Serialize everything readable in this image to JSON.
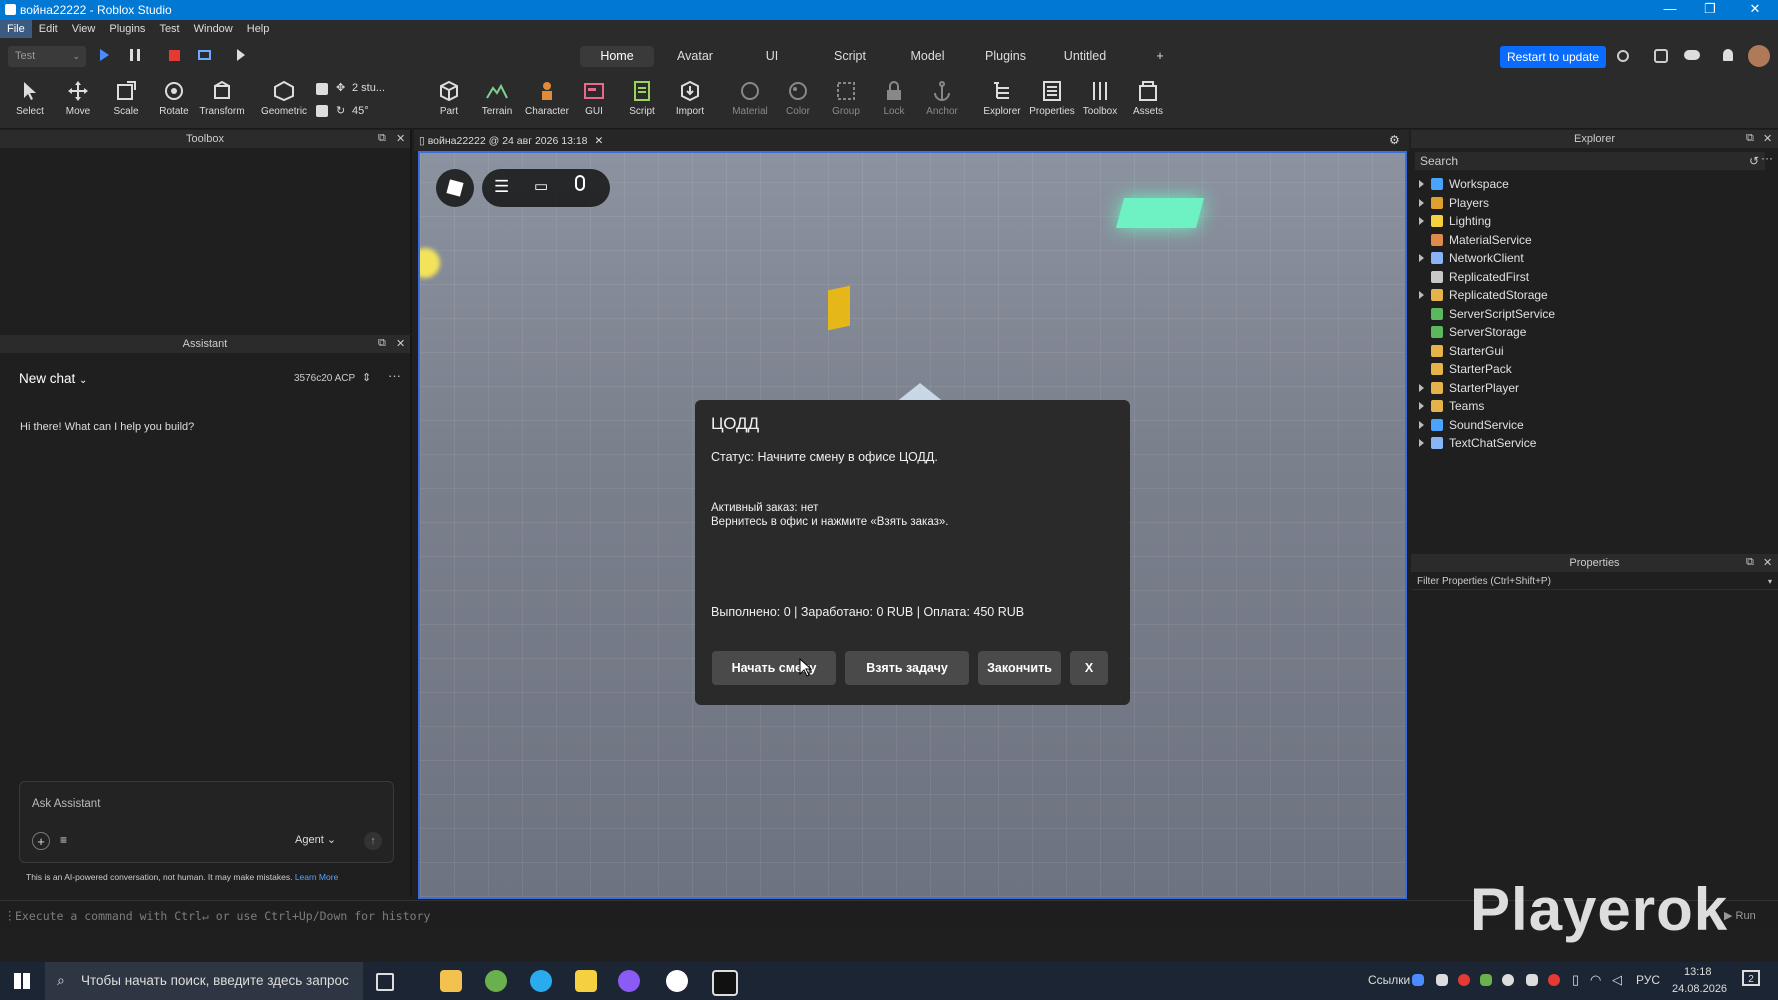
{
  "window": {
    "title": "война22222 - Roblox Studio",
    "controls": [
      "—",
      "❐",
      "✕"
    ]
  },
  "menu": [
    "File",
    "Edit",
    "View",
    "Plugins",
    "Test",
    "Window",
    "Help"
  ],
  "top": {
    "mode_select": "Test",
    "tabs": [
      "Home",
      "Avatar",
      "UI",
      "Script",
      "Model",
      "Plugins",
      "Untitled",
      "+"
    ],
    "active_tab": "Home",
    "restart_label": "Restart to update"
  },
  "ribbon": {
    "tools": [
      "Select",
      "Move",
      "Scale",
      "Rotate",
      "Transform",
      "Geometric"
    ],
    "move_snap": "2 stu...",
    "rotate_snap": "45°",
    "insert": [
      "Part",
      "Terrain",
      "Character",
      "GUI",
      "Script",
      "Import"
    ],
    "edit": [
      "Material",
      "Color",
      "Group",
      "Lock",
      "Anchor"
    ],
    "panels": [
      "Explorer",
      "Properties",
      "Toolbox",
      "Assets"
    ]
  },
  "toolbox": {
    "title": "Toolbox"
  },
  "assistant": {
    "title": "Assistant",
    "chat_title": "New chat",
    "tokens": "3576c20 ACP",
    "greeting": "Hi there! What can I help you build?",
    "input_placeholder": "Ask Assistant",
    "mode": "Agent",
    "disclaimer": "This is an AI-powered conversation, not human. It may make mistakes.",
    "learn_more": "Learn More"
  },
  "doc_tab": {
    "label": "война22222 @ 24 авг 2026 13:18"
  },
  "dialog": {
    "title": "ЦОДД",
    "status": "Статус: Начните смену в офисе ЦОДД.",
    "order_line1": "Активный заказ: нет",
    "order_line2": "Вернитесь в офис и нажмите «Взять заказ».",
    "stats": "Выполнено: 0 | Заработано: 0 RUB | Оплата: 450 RUB",
    "btn_start": "Начать смену",
    "btn_take": "Взять задачу",
    "btn_finish": "Закончить",
    "btn_close": "X"
  },
  "explorer": {
    "title": "Explorer",
    "search_placeholder": "Search",
    "items": [
      {
        "label": "Workspace",
        "expandable": true,
        "color": "#4aa3ff"
      },
      {
        "label": "Players",
        "expandable": true,
        "color": "#e0a030"
      },
      {
        "label": "Lighting",
        "expandable": true,
        "color": "#f5d142"
      },
      {
        "label": "MaterialService",
        "expandable": false,
        "color": "#e08a4a"
      },
      {
        "label": "NetworkClient",
        "expandable": true,
        "color": "#8ab4f8"
      },
      {
        "label": "ReplicatedFirst",
        "expandable": false,
        "color": "#c8c8c8"
      },
      {
        "label": "ReplicatedStorage",
        "expandable": true,
        "color": "#e6b34a"
      },
      {
        "label": "ServerScriptService",
        "expandable": false,
        "color": "#5cb85c"
      },
      {
        "label": "ServerStorage",
        "expandable": false,
        "color": "#5cb85c"
      },
      {
        "label": "StarterGui",
        "expandable": false,
        "color": "#e6b34a"
      },
      {
        "label": "StarterPack",
        "expandable": false,
        "color": "#e6b34a"
      },
      {
        "label": "StarterPlayer",
        "expandable": true,
        "color": "#e6b34a"
      },
      {
        "label": "Teams",
        "expandable": true,
        "color": "#e6b34a"
      },
      {
        "label": "SoundService",
        "expandable": true,
        "color": "#4aa3ff"
      },
      {
        "label": "TextChatService",
        "expandable": true,
        "color": "#8ab4f8"
      }
    ]
  },
  "properties": {
    "title": "Properties",
    "filter_placeholder": "Filter Properties (Ctrl+Shift+P)"
  },
  "command": {
    "placeholder": "Execute a command with Ctrl↵ or use Ctrl+Up/Down for history",
    "run_label": "Run"
  },
  "watermark": "Playerok",
  "taskbar": {
    "search_placeholder": "Чтобы начать поиск, введите здесь запрос",
    "links_label": "Ссылки",
    "lang": "РУС",
    "time": "13:18",
    "date": "24.08.2026",
    "notifications": "2"
  },
  "colors": {
    "accent": "#0078d4",
    "restart": "#0a6cff",
    "viewport_border": "#3b6ddc"
  }
}
